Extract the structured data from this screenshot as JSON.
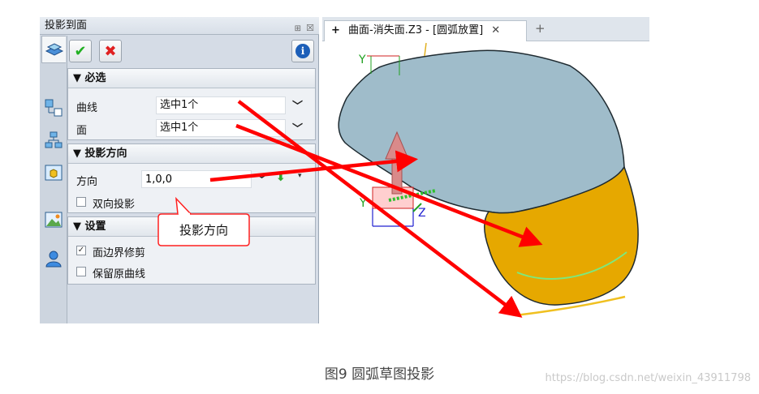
{
  "panel": {
    "title": "投影到面",
    "pin_glyph": "⊞",
    "close_glyph": "☒"
  },
  "toolbar": {
    "ok": "✔",
    "cancel": "✖",
    "info": "i"
  },
  "groups": {
    "required": {
      "header": "▼ 必选",
      "curve_label": "曲线",
      "curve_value": "选中1个",
      "face_label": "面",
      "face_value": "选中1个"
    },
    "direction": {
      "header": "▼ 投影方向",
      "direction_label": "方向",
      "direction_value": "1,0,0",
      "bidirectional_label": "双向投影",
      "bidirectional_checked": false
    },
    "settings": {
      "header": "▼ 设置",
      "trim_label": "面边界修剪",
      "trim_checked": true,
      "keep_label": "保留原曲线",
      "keep_checked": false
    }
  },
  "callout": {
    "text": "投影方向"
  },
  "viewport": {
    "tab_label": "曲面-消失面.Z3 - [圆弧放置]",
    "tab_close": "✕",
    "new_tab": "+",
    "tab_plus": "+",
    "axis_y": "Y",
    "axis_y2": "Y",
    "axis_z": "Z"
  },
  "caption": "图9 圆弧草图投影",
  "watermark": "https://blog.csdn.net/weixin_43911798",
  "colors": {
    "annotation_red": "#ff0000",
    "surface_blue": "#9fbcca",
    "surface_gold": "#e6a800",
    "projected_curve": "#f0c020",
    "arc_green": "#7de87d"
  }
}
